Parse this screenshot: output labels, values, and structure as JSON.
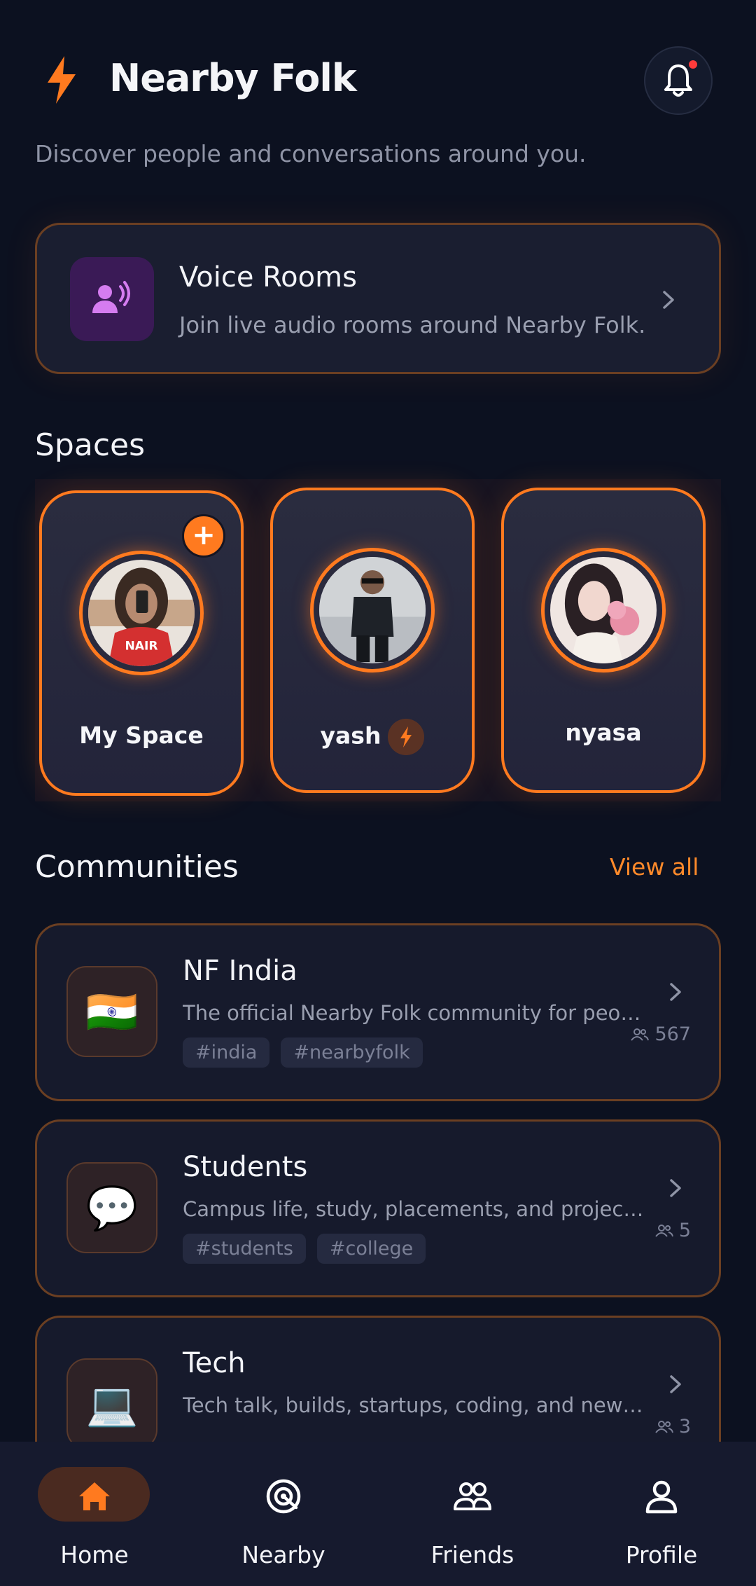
{
  "header": {
    "title": "Nearby Folk",
    "subtitle": "Discover people and conversations around you."
  },
  "voice_rooms": {
    "title": "Voice Rooms",
    "description": "Join live audio rooms around Nearby Folk."
  },
  "spaces": {
    "title": "Spaces",
    "items": [
      {
        "name": "My Space",
        "badge": "+"
      },
      {
        "name": "yash"
      },
      {
        "name": "nyasa"
      }
    ]
  },
  "communities": {
    "title": "Communities",
    "view_all": "View all",
    "items": [
      {
        "icon": "🇮🇳",
        "name": "NF India",
        "description": "The official Nearby Folk community for people across India.",
        "tags": [
          "#india",
          "#nearbyfolk"
        ],
        "members": "567"
      },
      {
        "icon": "💬",
        "name": "Students",
        "description": "Campus life, study, placements, and projects.",
        "tags": [
          "#students",
          "#college"
        ],
        "members": "5"
      },
      {
        "icon": "💻",
        "name": "Tech",
        "description": "Tech talk, builds, startups, coding, and new ideas.",
        "tags": [],
        "members": "3"
      }
    ]
  },
  "nav": {
    "home": "Home",
    "nearby": "Nearby",
    "friends": "Friends",
    "profile": "Profile"
  },
  "colors": {
    "accent": "#ff7a1f",
    "background": "#0c1120",
    "card": "#161a2c"
  }
}
